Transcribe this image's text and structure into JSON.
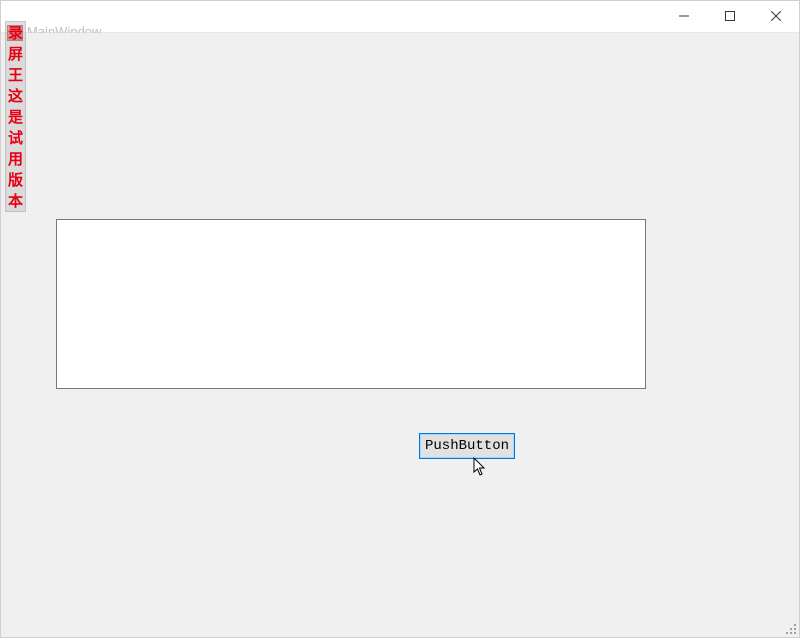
{
  "window": {
    "underlying_title": "MainWindow",
    "watermark_text": "录屏王 这是试用版本"
  },
  "main": {
    "textedit_value": "",
    "button_label": "PushButton"
  }
}
